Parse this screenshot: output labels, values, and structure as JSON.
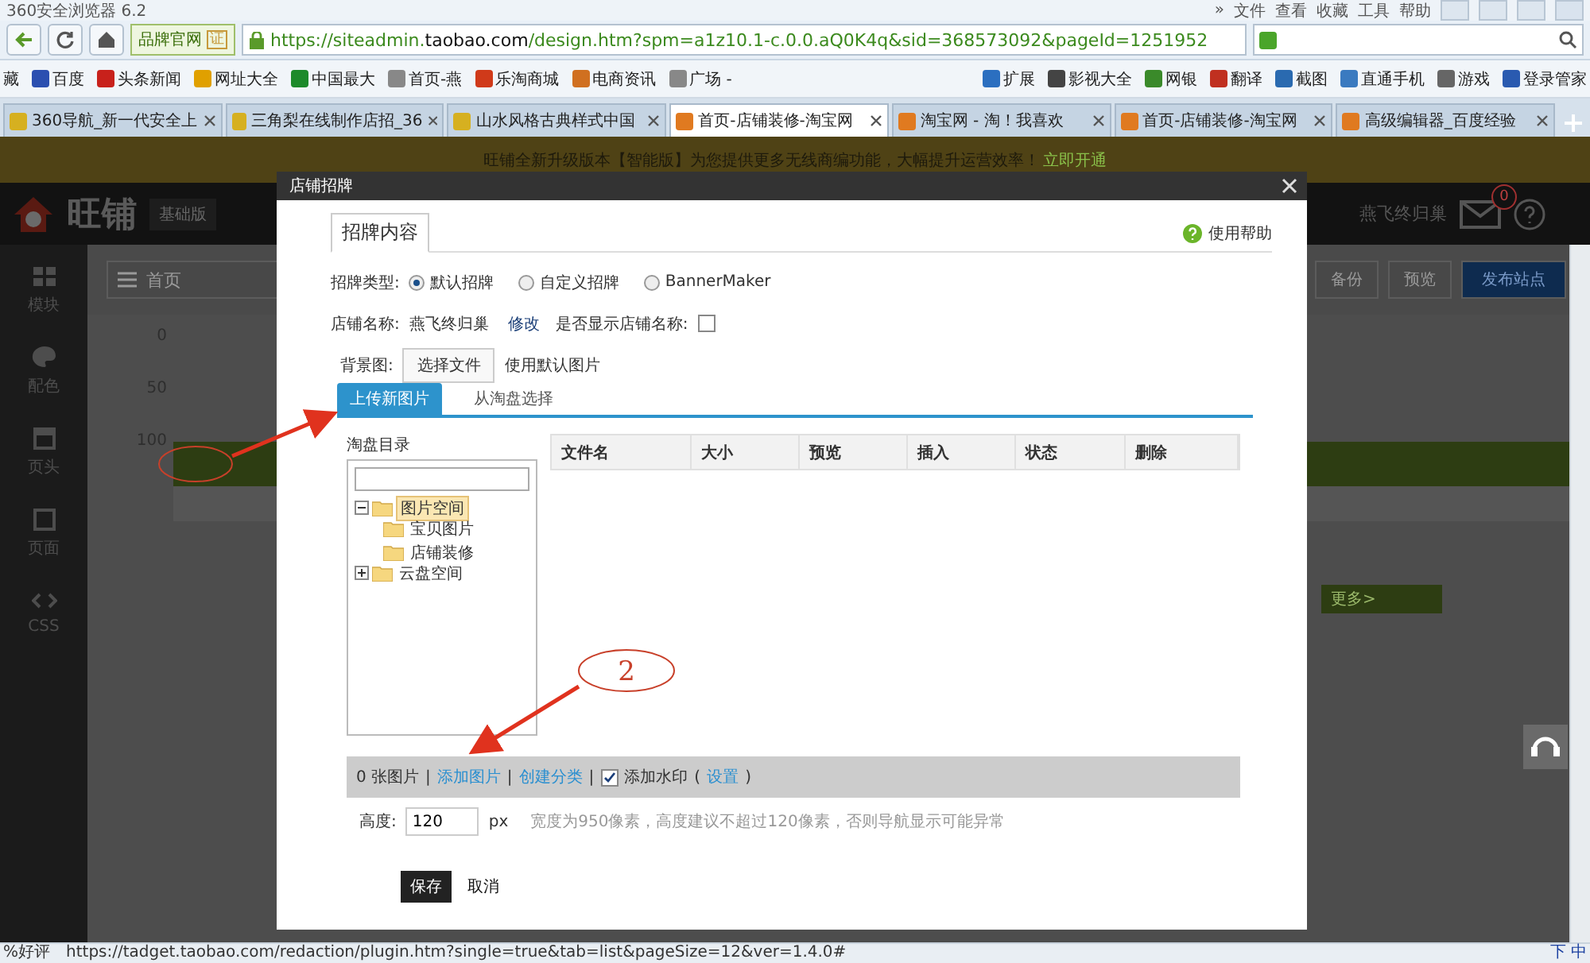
{
  "browser": {
    "title": "360安全浏览器 6.2",
    "menu": [
      "»",
      "文件",
      "查看",
      "收藏",
      "工具",
      "帮助"
    ]
  },
  "address_bar": {
    "site_badge": "品牌官网",
    "badge_mark": "证",
    "url": "https://siteadmin.**taobao.com**/design.htm?spm=a1z10.1-c.0.0.aQ0K4q&sid=368573092&pageId=1251952"
  },
  "bookmarks": [
    "藏",
    "百度",
    "头条新闻",
    "网址大全",
    "中国最大",
    "首页-燕",
    "乐淘商城",
    "电商资讯",
    "广场 -"
  ],
  "bookmarks_right": [
    "扩展",
    "影视大全",
    "网银",
    "翻译",
    "截图",
    "直通手机",
    "游戏",
    "登录管家"
  ],
  "tabs": [
    {
      "label": "360导航_新一代安全上",
      "selected": false
    },
    {
      "label": "三角梨在线制作店招_36",
      "selected": false
    },
    {
      "label": "山水风格古典样式中国",
      "selected": false
    },
    {
      "label": "首页-店铺装修-淘宝网",
      "selected": true
    },
    {
      "label": "淘宝网 - 淘！我喜欢",
      "selected": false
    },
    {
      "label": "首页-店铺装修-淘宝网",
      "selected": false
    },
    {
      "label": "高级编辑器_百度经验",
      "selected": false
    }
  ],
  "banner": {
    "text": "旺铺全新升级版本【智能版】为您提供更多无线商编功能，大幅提升运营效率！",
    "link": "立即开通"
  },
  "app_header": {
    "logo": "旺铺",
    "edition": "基础版",
    "shop": "燕飞终归巢",
    "mail_count": "0"
  },
  "sidebar": [
    "模块",
    "配色",
    "页头",
    "页面",
    "CSS"
  ],
  "toolbar": {
    "page_select": "首页",
    "buttons": [
      "备份",
      "预览",
      "发布站点"
    ]
  },
  "ruler": [
    "0",
    "50",
    "100"
  ],
  "more_link": "更多>",
  "dialog": {
    "title": "店铺招牌",
    "tab": "招牌内容",
    "help": "使用帮助",
    "sign_type": {
      "label": "招牌类型:",
      "options": [
        {
          "label": "默认招牌",
          "selected": true
        },
        {
          "label": "自定义招牌",
          "selected": false
        },
        {
          "label": "BannerMaker",
          "selected": false
        }
      ]
    },
    "shop_name": {
      "label": "店铺名称:",
      "value": "燕飞终归巢",
      "edit": "修改",
      "show_label": "是否显示店铺名称:",
      "checked": false
    },
    "background": {
      "label": "背景图:",
      "button": "选择文件",
      "hint": "使用默认图片"
    },
    "upload_tabs": [
      {
        "label": "上传新图片",
        "selected": true
      },
      {
        "label": "从淘盘选择",
        "selected": false
      }
    ],
    "tree": {
      "title": "淘盘目录",
      "items": [
        {
          "label": "图片空间",
          "expanded": true,
          "selected": true,
          "children": [
            {
              "label": "宝贝图片",
              "selected": false
            },
            {
              "label": "店铺装修",
              "selected": false
            }
          ]
        },
        {
          "label": "云盘空间",
          "expanded": false,
          "selected": false
        }
      ]
    },
    "table_columns": [
      "文件名",
      "大小",
      "预览",
      "插入",
      "状态",
      "删除"
    ],
    "footer": [
      {
        "kind": "text",
        "text": "0 张图片"
      },
      {
        "kind": "sep",
        "text": "|"
      },
      {
        "kind": "link",
        "text": "添加图片"
      },
      {
        "kind": "sep",
        "text": "|"
      },
      {
        "kind": "link",
        "text": "创建分类"
      },
      {
        "kind": "sep",
        "text": "|"
      },
      {
        "kind": "checkbox",
        "text": "添加水印",
        "checked": true
      },
      {
        "kind": "sep",
        "text": "("
      },
      {
        "kind": "link",
        "text": "设置"
      },
      {
        "kind": "sep",
        "text": ")"
      }
    ],
    "height": {
      "label": "高度:",
      "value": "120",
      "unit": "px",
      "hint": "宽度为950像素，高度建议不超过120像素，否则导航显示可能异常"
    },
    "save": "保存",
    "cancel": "取消"
  },
  "annotation": {
    "label": "2"
  },
  "status_bar": {
    "left": "%好评",
    "url": "https://tadget.taobao.com/redaction/plugin.htm?single=true&tab=list&pageSize=12&ver=1.4.0#",
    "tray": [
      "下",
      "中"
    ]
  }
}
